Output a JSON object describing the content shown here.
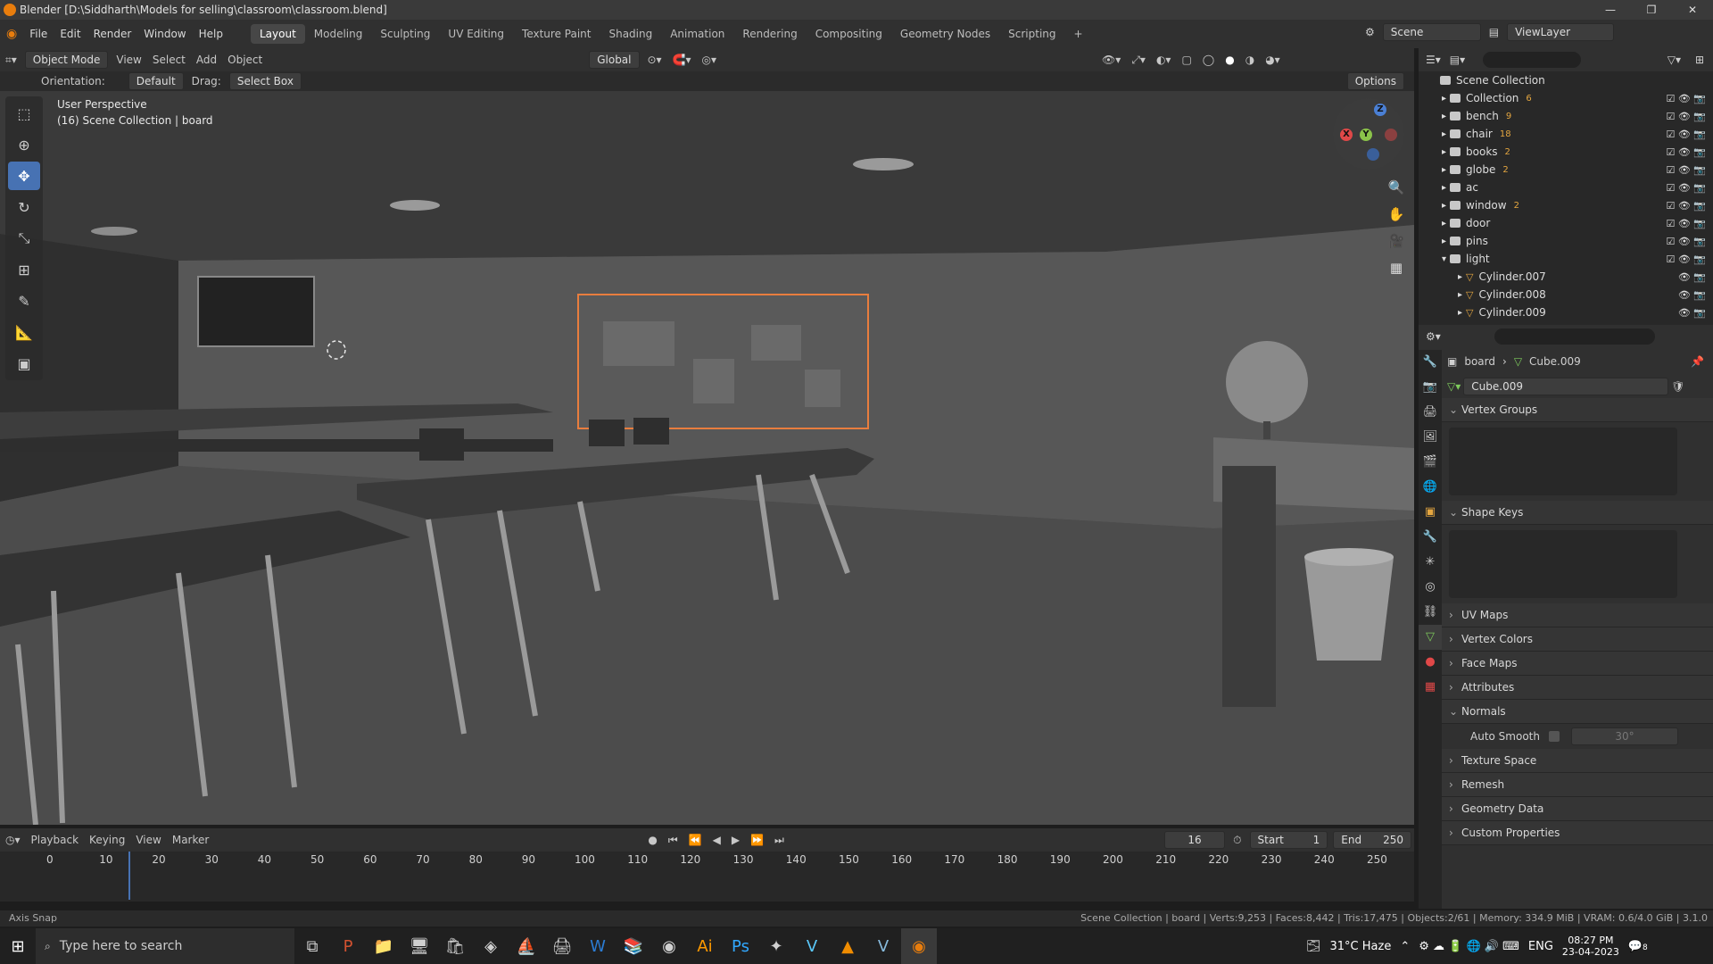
{
  "window": {
    "title": "Blender [D:\\Siddharth\\Models for selling\\classroom\\classroom.blend]",
    "controls": [
      "—",
      "❐",
      "✕"
    ]
  },
  "menu": {
    "items": [
      "File",
      "Edit",
      "Render",
      "Window",
      "Help"
    ]
  },
  "workspaces": [
    "Layout",
    "Modeling",
    "Sculpting",
    "UV Editing",
    "Texture Paint",
    "Shading",
    "Animation",
    "Rendering",
    "Compositing",
    "Geometry Nodes",
    "Scripting"
  ],
  "active_workspace": "Layout",
  "scene": {
    "name": "Scene",
    "view_layer": "ViewLayer"
  },
  "header3d": {
    "mode": "Object Mode",
    "menus": [
      "View",
      "Select",
      "Add",
      "Object"
    ],
    "transform": "Global"
  },
  "toolheader": {
    "orientation_label": "Orientation:",
    "orientation": "Default",
    "drag_label": "Drag:",
    "drag": "Select Box",
    "options": "Options"
  },
  "viewport": {
    "view_name": "User Perspective",
    "context": "(16) Scene Collection | board"
  },
  "gizmo": {
    "x": "X",
    "y": "Y",
    "z": "Z"
  },
  "outliner": {
    "root": "Scene Collection",
    "items": [
      {
        "name": "Collection",
        "count": "6",
        "type": "coll"
      },
      {
        "name": "bench",
        "count": "9",
        "type": "coll"
      },
      {
        "name": "chair",
        "count": "18",
        "type": "coll"
      },
      {
        "name": "books",
        "count": "2",
        "type": "coll"
      },
      {
        "name": "globe",
        "count": "2",
        "type": "coll"
      },
      {
        "name": "ac",
        "count": "",
        "type": "coll"
      },
      {
        "name": "window",
        "count": "2",
        "type": "coll"
      },
      {
        "name": "door",
        "count": "",
        "type": "coll"
      },
      {
        "name": "pins",
        "count": "",
        "type": "coll"
      },
      {
        "name": "light",
        "count": "",
        "type": "coll"
      },
      {
        "name": "Cylinder.007",
        "count": "",
        "type": "mesh"
      },
      {
        "name": "Cylinder.008",
        "count": "",
        "type": "mesh"
      },
      {
        "name": "Cylinder.009",
        "count": "",
        "type": "mesh"
      }
    ]
  },
  "properties": {
    "breadcrumb_object": "board",
    "breadcrumb_mesh": "Cube.009",
    "mesh_name": "Cube.009",
    "sections": [
      "Vertex Groups",
      "Shape Keys",
      "UV Maps",
      "Vertex Colors",
      "Face Maps",
      "Attributes",
      "Normals",
      "Texture Space",
      "Remesh",
      "Geometry Data",
      "Custom Properties"
    ],
    "auto_smooth_label": "Auto Smooth",
    "auto_smooth_angle": "30°"
  },
  "timeline": {
    "menus": [
      "Playback",
      "Keying",
      "View",
      "Marker"
    ],
    "current_frame": "16",
    "start_label": "Start",
    "start": "1",
    "end_label": "End",
    "end": "250",
    "ticks": [
      "0",
      "10",
      "20",
      "30",
      "40",
      "50",
      "60",
      "70",
      "80",
      "90",
      "100",
      "110",
      "120",
      "130",
      "140",
      "150",
      "160",
      "170",
      "180",
      "190",
      "200",
      "210",
      "220",
      "230",
      "240",
      "250"
    ]
  },
  "status": {
    "left": "Axis Snap",
    "right": "Scene Collection | board | Verts:9,253 | Faces:8,442 | Tris:17,475 | Objects:2/61 | Memory: 334.9 MiB | VRAM: 0.6/4.0 GiB | 3.1.0"
  },
  "taskbar": {
    "search_placeholder": "Type here to search",
    "weather": "31°C  Haze",
    "lang": "ENG",
    "time": "08:27 PM",
    "date": "23-04-2023",
    "notif": "8"
  },
  "colors": {
    "accent": "#4772b3",
    "selection": "#e87d3e",
    "orange": "#e87d0d"
  }
}
